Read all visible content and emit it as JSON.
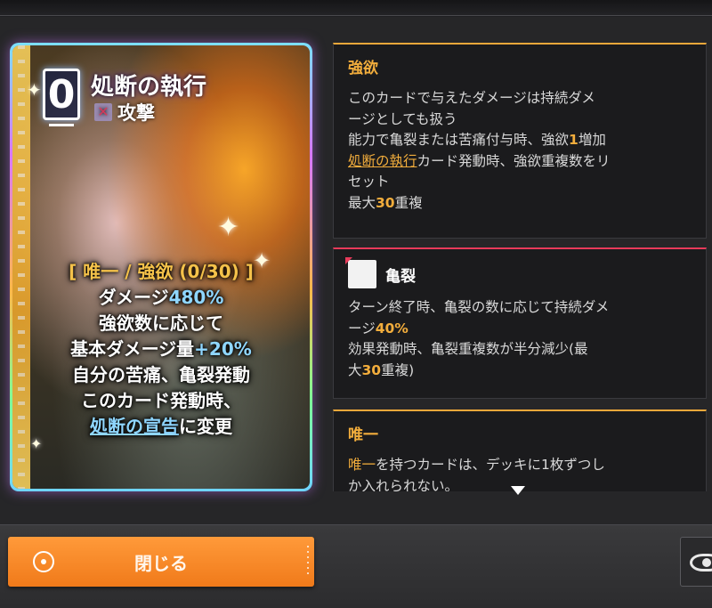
{
  "card": {
    "cost": "0",
    "name": "処断の執行",
    "type": "攻撃",
    "text": {
      "tag": "[ 唯一 / 強欲 (0/30) ]",
      "line1_prefix": "ダメージ",
      "line1_value": "480%",
      "line2": "強欲数に応じて",
      "line3_prefix": "基本ダメージ量",
      "line3_value": "+20%",
      "line4": "自分の苦痛、亀裂発動",
      "line5": "このカード発動時、",
      "line6_link": "処断の宣告",
      "line6_suffix": "に変更"
    }
  },
  "greed_panel": {
    "title": "強欲",
    "line1": "このカードで与えたダメージは持続ダメ",
    "line2": "ージとしても扱う",
    "line3_a": "能力で亀裂または苦痛付与時、強欲",
    "line3_num": "1",
    "line3_b": "増加",
    "line4_link": "処断の執行",
    "line4_b": "カード発動時、強欲重複数をリ",
    "line5": "セット",
    "line6_a": "最大",
    "line6_num": "30",
    "line6_b": "重複"
  },
  "crack_panel": {
    "icon": "crack-icon",
    "title": "亀裂",
    "line1": "ターン終了時、亀裂の数に応じて持続ダメ",
    "line2_a": "ージ",
    "line2_num": "40%",
    "line3": "効果発動時、亀裂重複数が半分減少(最",
    "line4_a": "大",
    "line4_num": "30",
    "line4_b": "重複)"
  },
  "unique_panel": {
    "title": "唯一",
    "line1_hl": "唯一",
    "line1_b": "を持つカードは、デッキに1枚ずつし",
    "line2": "か入れられない。"
  },
  "footer": {
    "close_label": "閉じる",
    "close_icon": "target-icon",
    "view_icon": "eye-icon"
  },
  "colors": {
    "accent_orange": "#f2ad3c",
    "accent_red": "#e83a5a",
    "button_orange": "#f07a1a",
    "highlight_blue": "#8fd6ff"
  }
}
